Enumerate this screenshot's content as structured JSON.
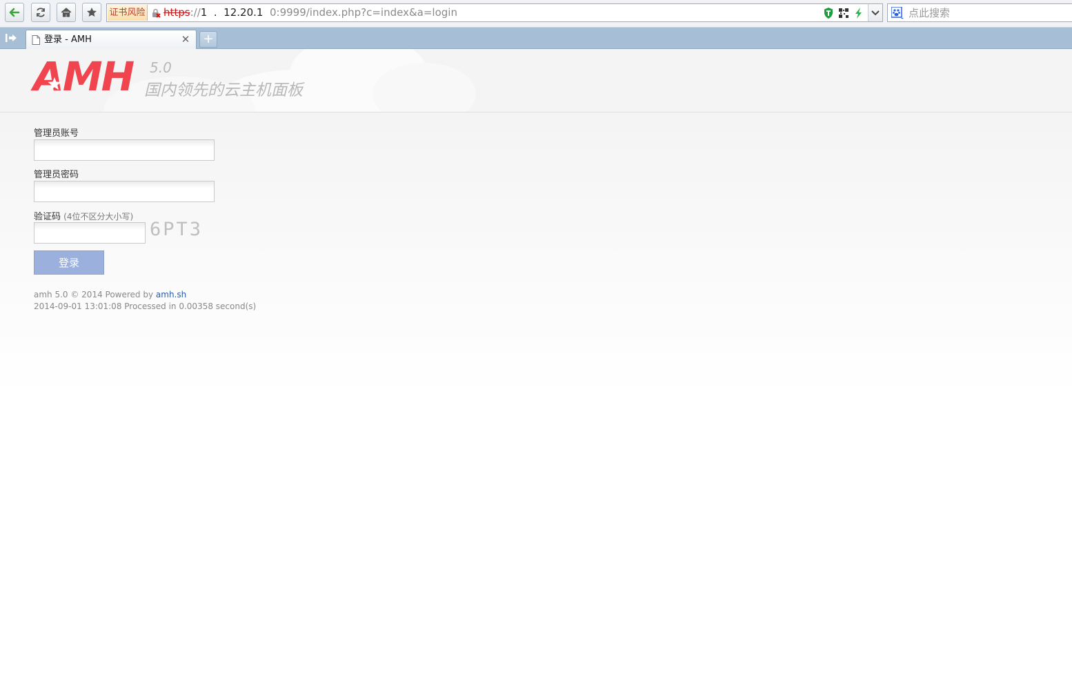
{
  "toolbar": {
    "back_icon": "arrow-left-icon",
    "reload_icon": "refresh-icon",
    "home_icon": "home-icon",
    "bookmark_icon": "star-icon"
  },
  "address_bar": {
    "cert_warning": "证书风险",
    "url_scheme": "https",
    "url_separator": "://",
    "url_host": "1",
    "url_host_obscured": "  .  12.20.1  ",
    "url_rest": "0:9999/index.php?c=index&a=login"
  },
  "search_bar": {
    "placeholder": "点此搜索"
  },
  "tab": {
    "title": "登录 - AMH",
    "close_glyph": "✕",
    "new_tab_glyph": "+"
  },
  "header": {
    "logo": "AMH",
    "version": "5.0",
    "slogan": "国内领先的云主机面板"
  },
  "form": {
    "username_label": "管理员账号",
    "password_label": "管理员密码",
    "captcha_label": "验证码",
    "captcha_hint": "(4位不区分大小写)",
    "captcha_code": "6PT3",
    "submit_label": "登录",
    "username_value": "",
    "password_value": "",
    "captcha_value": ""
  },
  "footer": {
    "line1_prefix": "amh 5.0 © 2014 Powered by ",
    "link_text": "amh.sh",
    "line2": "2014-09-01 13:01:08 Processed in 0.00358 second(s)"
  },
  "colors": {
    "logo_red": "#f0444f",
    "button_blue": "#9bb0dc",
    "tabstrip_blue": "#a6bfd6",
    "link_blue": "#2a5aa8"
  }
}
